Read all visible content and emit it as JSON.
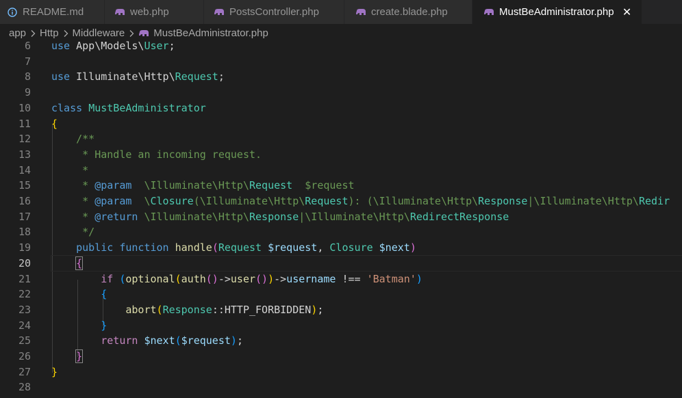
{
  "tabs": [
    {
      "label": "README.md",
      "icon": "info-icon",
      "active": false
    },
    {
      "label": "web.php",
      "icon": "php-elephant-icon",
      "active": false
    },
    {
      "label": "PostsController.php",
      "icon": "php-elephant-icon",
      "active": false
    },
    {
      "label": "create.blade.php",
      "icon": "php-elephant-icon",
      "active": false
    },
    {
      "label": "MustBeAdministrator.php",
      "icon": "php-elephant-icon",
      "active": true,
      "close": "✕"
    }
  ],
  "breadcrumb": {
    "items": [
      "app",
      "Http",
      "Middleware",
      "MustBeAdministrator.php"
    ]
  },
  "lines": [
    {
      "n": "6",
      "tokens": [
        [
          "kw",
          "use"
        ],
        [
          "pl",
          " "
        ],
        [
          "pl",
          "App\\Models\\"
        ],
        [
          "cls",
          "User"
        ],
        [
          "pl",
          ";"
        ]
      ]
    },
    {
      "n": "7",
      "tokens": []
    },
    {
      "n": "8",
      "tokens": [
        [
          "kw",
          "use"
        ],
        [
          "pl",
          " Illuminate\\Http\\"
        ],
        [
          "cls",
          "Request"
        ],
        [
          "pl",
          ";"
        ]
      ]
    },
    {
      "n": "9",
      "tokens": []
    },
    {
      "n": "10",
      "tokens": [
        [
          "kw",
          "class"
        ],
        [
          "pl",
          " "
        ],
        [
          "cls",
          "MustBeAdministrator"
        ]
      ]
    },
    {
      "n": "11",
      "tokens": [
        [
          "br1",
          "{"
        ]
      ]
    },
    {
      "n": "12",
      "tokens": [
        [
          "pl",
          "    "
        ],
        [
          "cmt",
          "/**"
        ]
      ]
    },
    {
      "n": "13",
      "tokens": [
        [
          "pl",
          "     "
        ],
        [
          "cmt",
          "* Handle an incoming request."
        ]
      ]
    },
    {
      "n": "14",
      "tokens": [
        [
          "pl",
          "     "
        ],
        [
          "cmt",
          "*"
        ]
      ]
    },
    {
      "n": "15",
      "tokens": [
        [
          "pl",
          "     "
        ],
        [
          "cmt",
          "* "
        ],
        [
          "kw",
          "@param"
        ],
        [
          "pl",
          "  "
        ],
        [
          "cmt",
          "\\Illuminate\\Http\\"
        ],
        [
          "cls",
          "Request"
        ],
        [
          "pl",
          "  "
        ],
        [
          "cmt",
          "$request"
        ]
      ]
    },
    {
      "n": "16",
      "tokens": [
        [
          "pl",
          "     "
        ],
        [
          "cmt",
          "* "
        ],
        [
          "kw",
          "@param"
        ],
        [
          "pl",
          "  "
        ],
        [
          "cmt",
          "\\"
        ],
        [
          "cls",
          "Closure"
        ],
        [
          "cmt",
          "(\\Illuminate\\Http\\"
        ],
        [
          "cls",
          "Request"
        ],
        [
          "cmt",
          "): (\\Illuminate\\Http\\"
        ],
        [
          "cls",
          "Response"
        ],
        [
          "cmt",
          "|\\Illuminate\\Http\\"
        ],
        [
          "cls",
          "Redir"
        ]
      ]
    },
    {
      "n": "17",
      "tokens": [
        [
          "pl",
          "     "
        ],
        [
          "cmt",
          "* "
        ],
        [
          "kw",
          "@return"
        ],
        [
          "pl",
          " "
        ],
        [
          "cmt",
          "\\Illuminate\\Http\\"
        ],
        [
          "cls",
          "Response"
        ],
        [
          "cmt",
          "|\\Illuminate\\Http\\"
        ],
        [
          "cls",
          "RedirectResponse"
        ]
      ]
    },
    {
      "n": "18",
      "tokens": [
        [
          "pl",
          "     "
        ],
        [
          "cmt",
          "*/"
        ]
      ]
    },
    {
      "n": "19",
      "tokens": [
        [
          "pl",
          "    "
        ],
        [
          "kw",
          "public"
        ],
        [
          "pl",
          " "
        ],
        [
          "kw",
          "function"
        ],
        [
          "pl",
          " "
        ],
        [
          "fn",
          "handle"
        ],
        [
          "br2",
          "("
        ],
        [
          "cls",
          "Request"
        ],
        [
          "pl",
          " "
        ],
        [
          "var",
          "$request"
        ],
        [
          "pl",
          ", "
        ],
        [
          "cls",
          "Closure"
        ],
        [
          "pl",
          " "
        ],
        [
          "var",
          "$next"
        ],
        [
          "br2",
          ")"
        ]
      ]
    },
    {
      "n": "20",
      "tokens": [
        [
          "pl",
          "    "
        ],
        [
          "br2",
          "{"
        ]
      ],
      "current": true
    },
    {
      "n": "21",
      "tokens": [
        [
          "pl",
          "        "
        ],
        [
          "ctl",
          "if"
        ],
        [
          "pl",
          " "
        ],
        [
          "br3",
          "("
        ],
        [
          "fn",
          "optional"
        ],
        [
          "br1",
          "("
        ],
        [
          "fn",
          "auth"
        ],
        [
          "br2",
          "()"
        ],
        [
          "pl",
          "->"
        ],
        [
          "fn",
          "user"
        ],
        [
          "br2",
          "()"
        ],
        [
          "br1",
          ")"
        ],
        [
          "pl",
          "->"
        ],
        [
          "var",
          "username"
        ],
        [
          "pl",
          " !== "
        ],
        [
          "str",
          "'Batman'"
        ],
        [
          "br3",
          ")"
        ]
      ]
    },
    {
      "n": "22",
      "tokens": [
        [
          "pl",
          "        "
        ],
        [
          "br3",
          "{"
        ]
      ]
    },
    {
      "n": "23",
      "tokens": [
        [
          "pl",
          "            "
        ],
        [
          "fn",
          "abort"
        ],
        [
          "br1",
          "("
        ],
        [
          "cls",
          "Response"
        ],
        [
          "pl",
          "::HTTP_FORBIDDEN"
        ],
        [
          "br1",
          ")"
        ],
        [
          "pl",
          ";"
        ]
      ]
    },
    {
      "n": "24",
      "tokens": [
        [
          "pl",
          "        "
        ],
        [
          "br3",
          "}"
        ]
      ]
    },
    {
      "n": "25",
      "tokens": [
        [
          "pl",
          "        "
        ],
        [
          "ctl",
          "return"
        ],
        [
          "pl",
          " "
        ],
        [
          "var",
          "$next"
        ],
        [
          "br3",
          "("
        ],
        [
          "var",
          "$request"
        ],
        [
          "br3",
          ")"
        ],
        [
          "pl",
          ";"
        ]
      ]
    },
    {
      "n": "26",
      "tokens": [
        [
          "pl",
          "    "
        ],
        [
          "br2",
          "}"
        ]
      ]
    },
    {
      "n": "27",
      "tokens": [
        [
          "br1",
          "}"
        ]
      ]
    },
    {
      "n": "28",
      "tokens": []
    }
  ]
}
